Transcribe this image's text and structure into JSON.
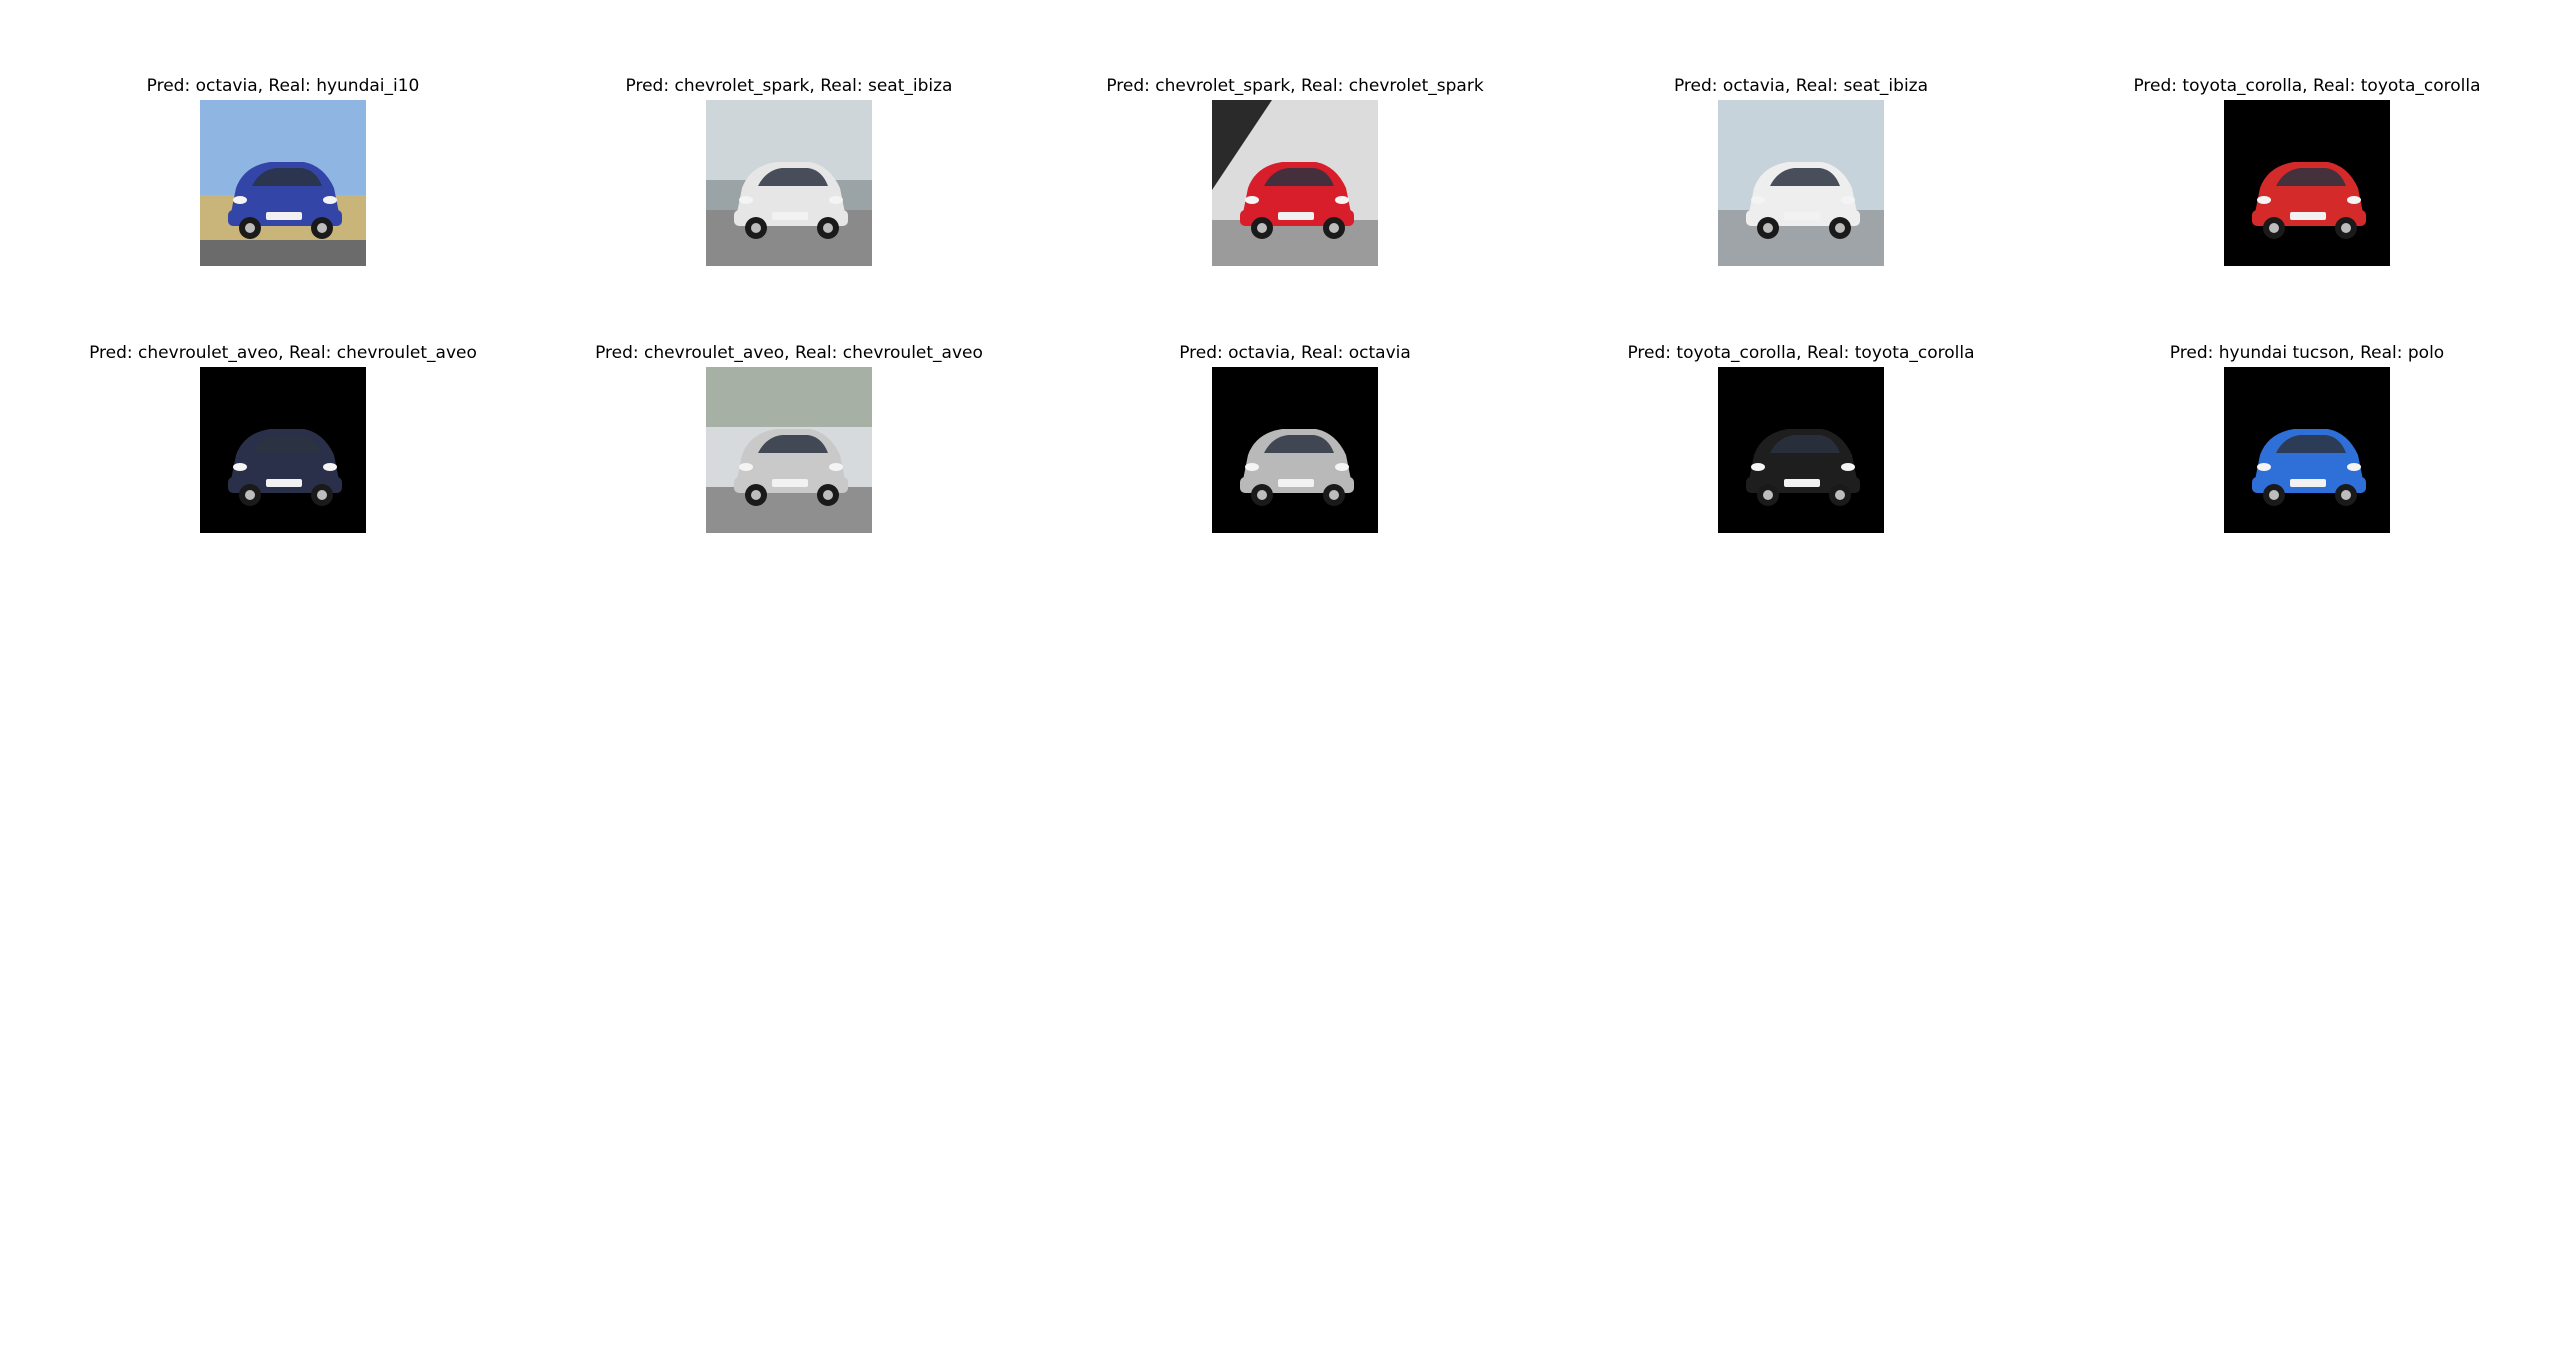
{
  "grid": {
    "rows": [
      [
        {
          "caption": "Pred: octavia, Real: hyundai_i10",
          "car_color": "#3346a8",
          "bg": "outdoor-field",
          "icon": "car-image"
        },
        {
          "caption": "Pred: chevrolet_spark, Real: seat_ibiza",
          "car_color": "#e6e6e6",
          "bg": "outdoor-gray",
          "icon": "car-image"
        },
        {
          "caption": "Pred: chevrolet_spark, Real: chevrolet_spark",
          "car_color": "#d81e2a",
          "bg": "studio-gray",
          "icon": "car-image"
        },
        {
          "caption": "Pred: octavia, Real: seat_ibiza",
          "car_color": "#eeeeee",
          "bg": "outdoor-sky",
          "icon": "car-image"
        },
        {
          "caption": "Pred: toyota_corolla, Real: toyota_corolla",
          "car_color": "#d42a2a",
          "bg": "black",
          "icon": "car-image"
        }
      ],
      [
        {
          "caption": "Pred: chevroulet_aveo, Real: chevroulet_aveo",
          "car_color": "#2a2f4a",
          "bg": "black",
          "icon": "car-image"
        },
        {
          "caption": "Pred: chevroulet_aveo, Real: chevroulet_aveo",
          "car_color": "#c9c9c9",
          "bg": "outdoor-street",
          "icon": "car-image"
        },
        {
          "caption": "Pred: octavia, Real: octavia",
          "car_color": "#b9b9b9",
          "bg": "black",
          "icon": "car-image"
        },
        {
          "caption": "Pred: toyota_corolla, Real: toyota_corolla",
          "car_color": "#1e1e1e",
          "bg": "black",
          "icon": "car-image"
        },
        {
          "caption": "Pred: hyundai tucson, Real: polo",
          "car_color": "#2f6fd8",
          "bg": "black",
          "icon": "car-image"
        }
      ]
    ]
  }
}
